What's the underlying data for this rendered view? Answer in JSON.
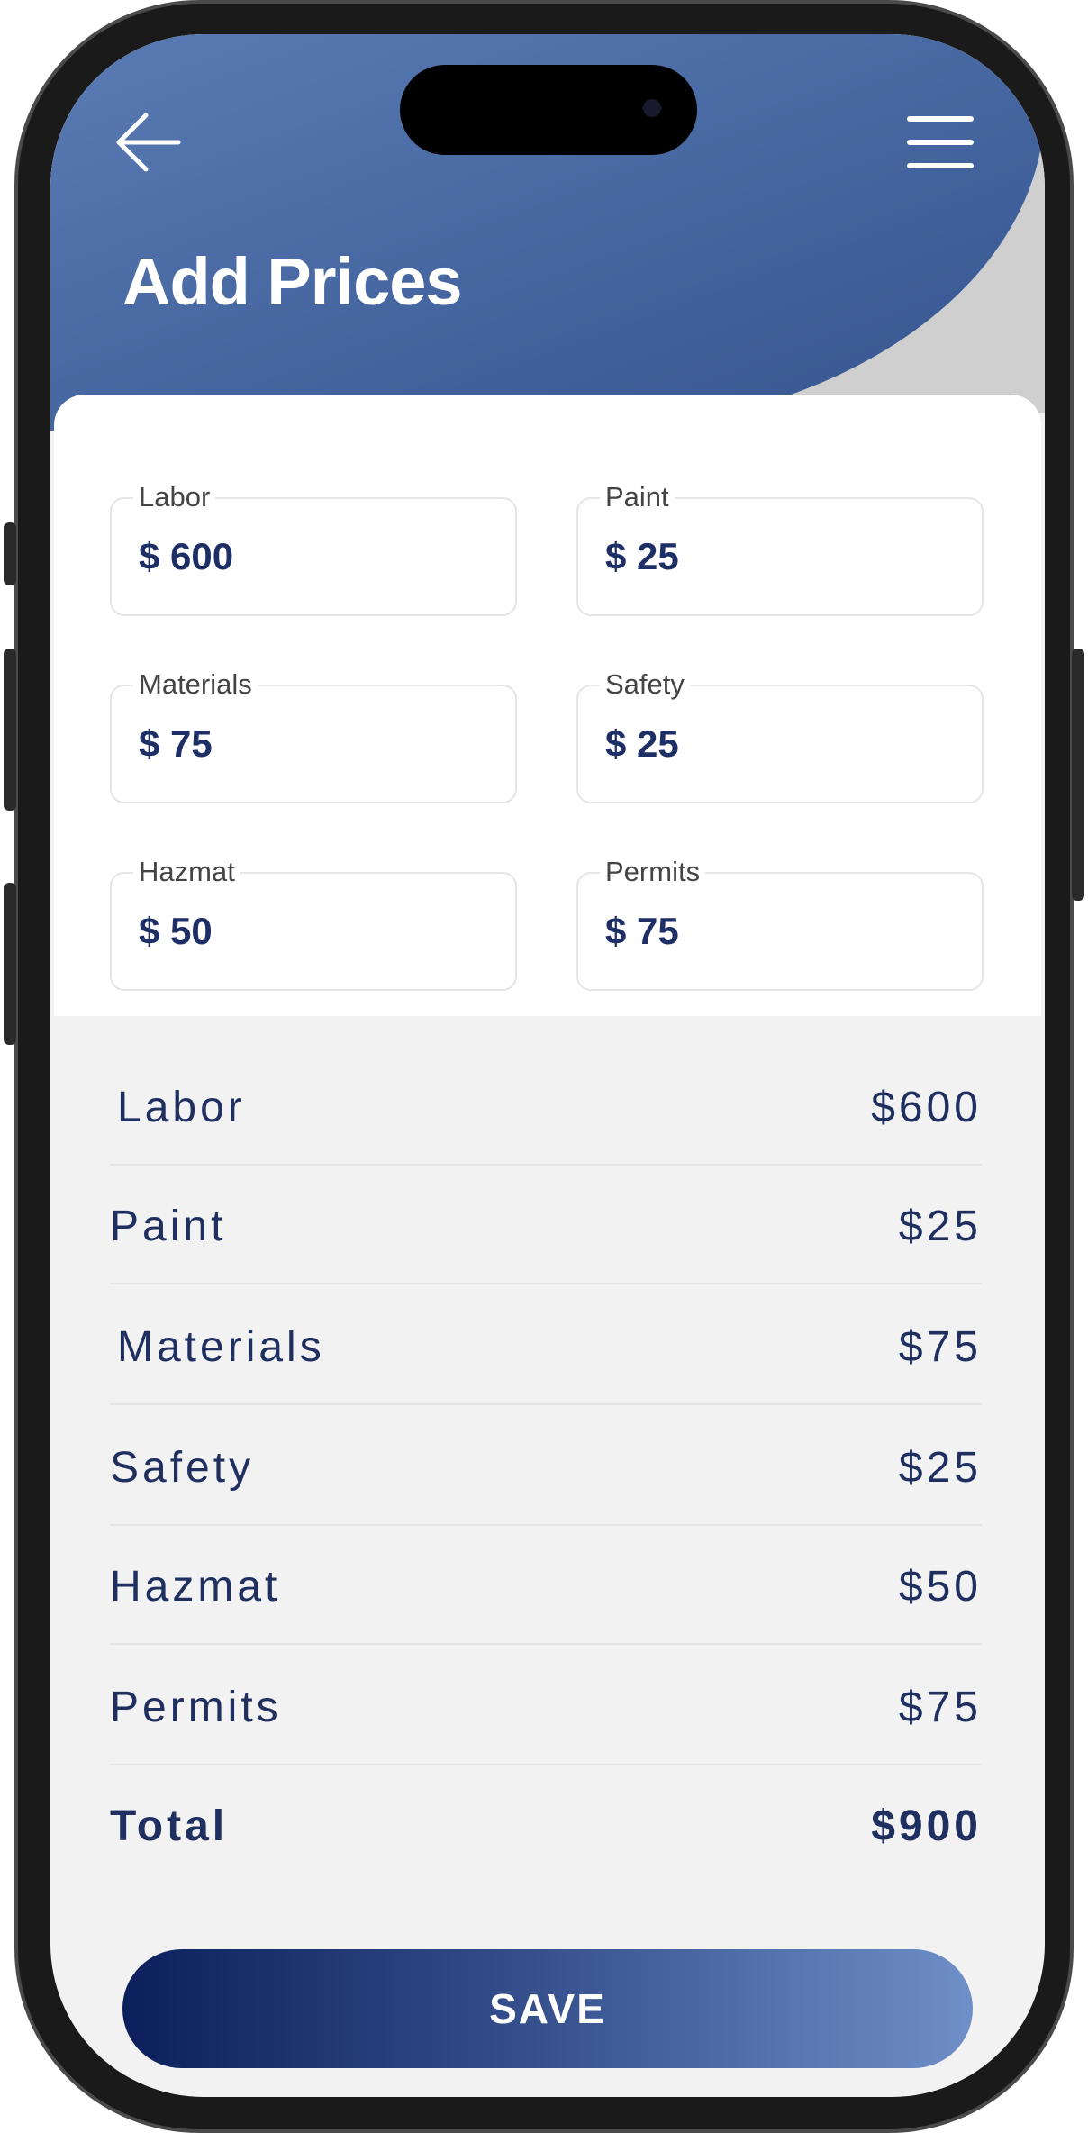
{
  "header": {
    "title": "Add Prices"
  },
  "fields": [
    {
      "label": "Labor",
      "value": "$ 600"
    },
    {
      "label": "Paint",
      "value": "$ 25"
    },
    {
      "label": "Materials",
      "value": "$ 75"
    },
    {
      "label": "Safety",
      "value": "$ 25"
    },
    {
      "label": "Hazmat",
      "value": "$ 50"
    },
    {
      "label": "Permits",
      "value": "$ 75"
    }
  ],
  "summary": {
    "rows": [
      {
        "label": "Labor",
        "value": "$600"
      },
      {
        "label": "Paint",
        "value": "$25"
      },
      {
        "label": "Materials",
        "value": "$75"
      },
      {
        "label": "Safety",
        "value": "$25"
      },
      {
        "label": "Hazmat",
        "value": "$50"
      },
      {
        "label": "Permits",
        "value": "$75"
      }
    ],
    "total": {
      "label": "Total",
      "value": "$900"
    }
  },
  "actions": {
    "save_label": "SAVE"
  },
  "icons": {
    "back": "arrow-left-icon",
    "menu": "hamburger-menu-icon"
  },
  "colors": {
    "header": "#4a6aa6",
    "text_dark": "#1f2f60",
    "button_start": "#0c1f5c",
    "button_end": "#6f8fc8"
  }
}
